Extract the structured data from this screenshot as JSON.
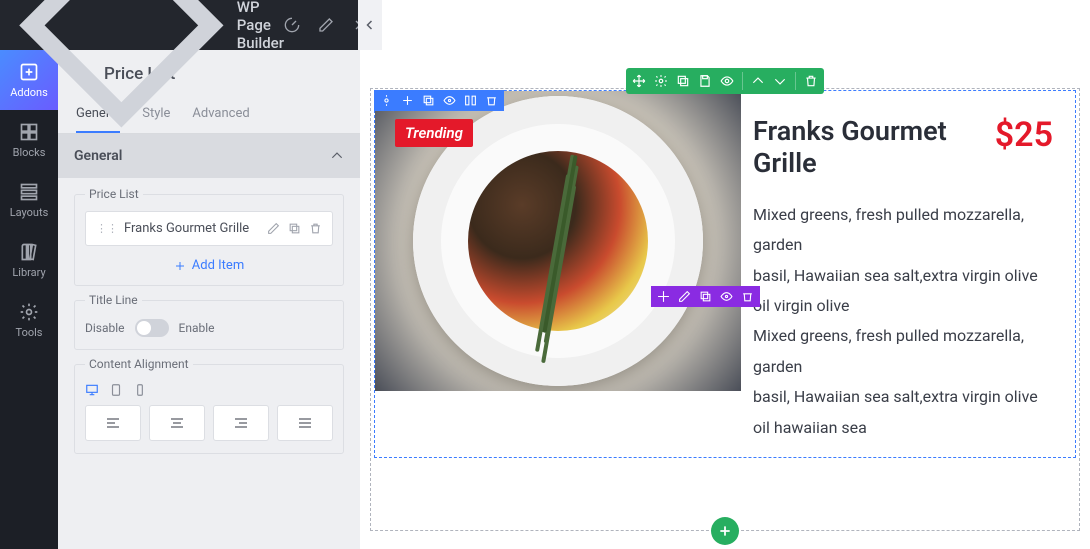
{
  "app": {
    "title": "WP Page Builder"
  },
  "rail": {
    "addons": "Addons",
    "blocks": "Blocks",
    "layouts": "Layouts",
    "library": "Library",
    "tools": "Tools"
  },
  "panel": {
    "title": "Price List",
    "tabs": {
      "general": "General",
      "style": "Style",
      "advanced": "Advanced"
    },
    "sections": {
      "general": "General",
      "price_list_label": "Price List",
      "price_list_item": "Franks Gourmet Grille",
      "add_item": "Add Item",
      "title_line_label": "Title Line",
      "disable": "Disable",
      "enable": "Enable",
      "content_alignment": "Content Alignment"
    }
  },
  "preview": {
    "badge": "Trending",
    "title": "Franks Gourmet Grille",
    "price": "$25",
    "desc1": "Mixed greens, fresh pulled mozzarella, garden",
    "desc2": "basil, Hawaiian sea salt,extra virgin olive oil virgin olive",
    "desc3": "Mixed greens, fresh pulled mozzarella, garden",
    "desc4": "basil, Hawaiian sea salt,extra virgin olive oil hawaiian sea"
  }
}
